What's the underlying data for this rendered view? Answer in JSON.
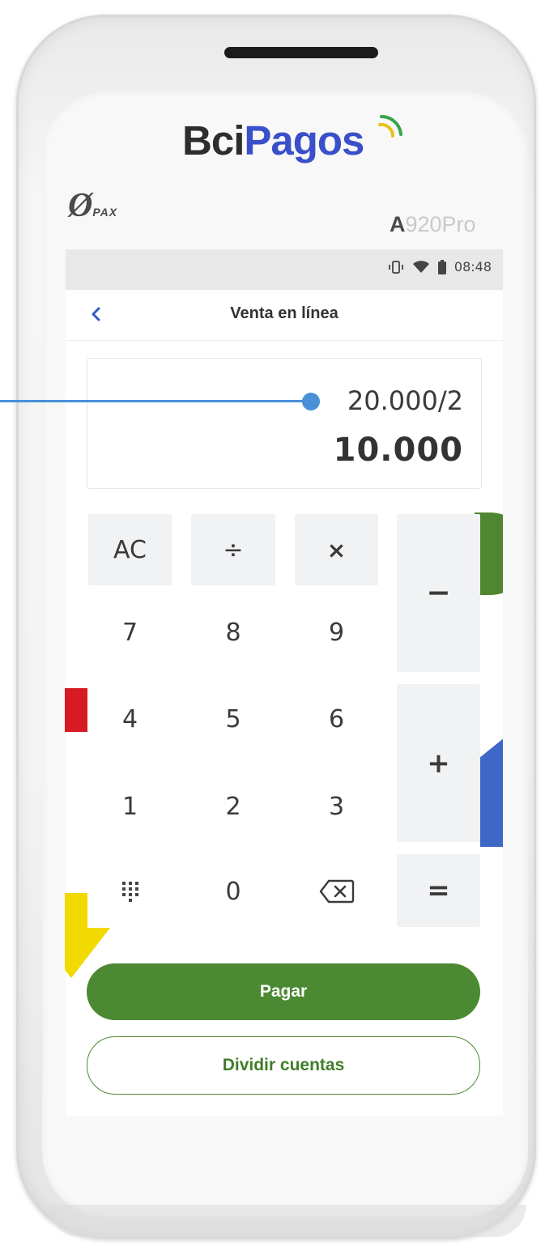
{
  "device": {
    "brand_bci": "Bci",
    "brand_pagos": "Pagos",
    "maker": "PAX",
    "model_letter": "A",
    "model_rest": "920Pro"
  },
  "status": {
    "time": "08:48"
  },
  "header": {
    "title": "Venta en línea",
    "back_label": "<"
  },
  "display": {
    "expression": "20.000/2",
    "result": "10.000"
  },
  "keypad": {
    "clear": "AC",
    "divide": "÷",
    "multiply": "×",
    "minus": "−",
    "plus": "+",
    "equals": "=",
    "digits": [
      "7",
      "8",
      "9",
      "4",
      "5",
      "6",
      "1",
      "2",
      "3",
      "0"
    ]
  },
  "actions": {
    "pay": "Pagar",
    "split": "Dividir cuentas"
  },
  "colors": {
    "accent_green": "#4b8a33",
    "accent_blue": "#3a4fc9",
    "callout": "#4a90d6"
  }
}
